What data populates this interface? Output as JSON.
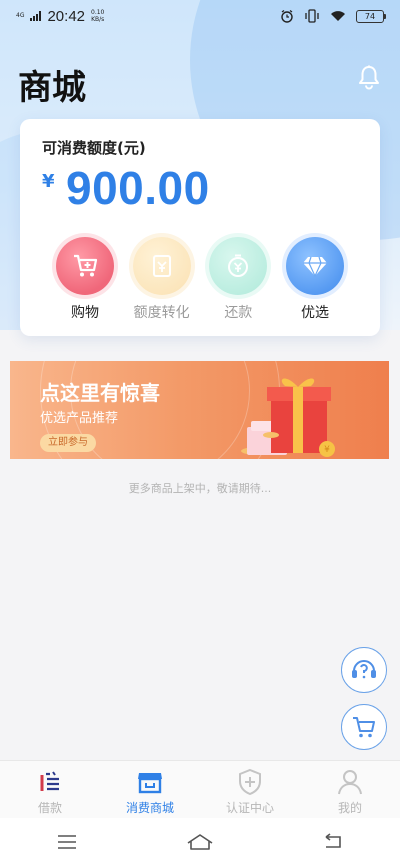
{
  "status_bar": {
    "network": "4G",
    "time": "20:42",
    "speed_value": "0.10",
    "speed_unit": "KB/s",
    "battery": "74",
    "icons": [
      "alarm-icon",
      "vibrate-icon",
      "wifi-icon",
      "battery-icon"
    ]
  },
  "header": {
    "title": "商城",
    "notification_icon": "bell-icon"
  },
  "credit_card": {
    "label": "可消费额度(元)",
    "currency_symbol": "¥",
    "amount": "900.00",
    "actions": [
      {
        "label": "购物",
        "icon": "shopping-cart-icon",
        "enabled": true
      },
      {
        "label": "额度转化",
        "icon": "quota-convert-icon",
        "enabled": false
      },
      {
        "label": "还款",
        "icon": "repay-icon",
        "enabled": false
      },
      {
        "label": "优选",
        "icon": "diamond-icon",
        "enabled": true
      }
    ]
  },
  "banner": {
    "title": "点这里有惊喜",
    "subtitle": "优选产品推荐",
    "button": "立即参与"
  },
  "coming_soon": "更多商品上架中，敬请期待...",
  "floating": [
    "help-icon",
    "cart-icon"
  ],
  "bottom_nav": [
    {
      "label": "借款",
      "icon": "loan-icon",
      "active": false
    },
    {
      "label": "消费商城",
      "icon": "store-icon",
      "active": true
    },
    {
      "label": "认证中心",
      "icon": "shield-plus-icon",
      "active": false
    },
    {
      "label": "我的",
      "icon": "user-icon",
      "active": false
    }
  ],
  "colors": {
    "accent": "#2f80e6",
    "inactive": "#b6b6b6",
    "banner": "#f39a68"
  }
}
